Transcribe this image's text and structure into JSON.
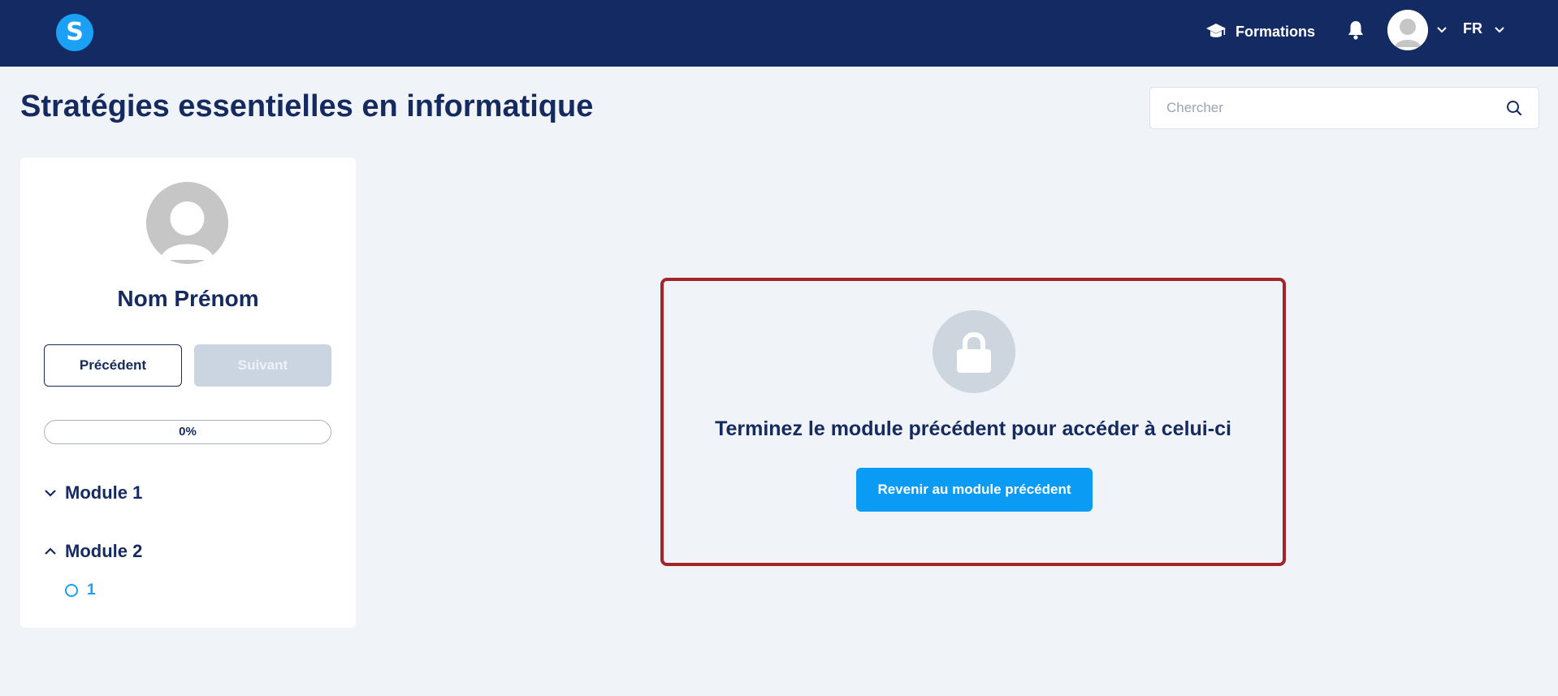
{
  "header": {
    "logo_letter": "S",
    "nav_formations": "Formations",
    "language": "FR"
  },
  "page": {
    "title": "Stratégies essentielles en informatique"
  },
  "search": {
    "placeholder": "Chercher",
    "value": ""
  },
  "sidebar": {
    "user_name": "Nom Prénom",
    "prev_label": "Précédent",
    "next_label": "Suivant",
    "progress_label": "0%",
    "progress_value": 0,
    "modules": [
      {
        "label": "Module 1",
        "expanded": false
      },
      {
        "label": "Module 2",
        "expanded": true,
        "lessons": [
          {
            "label": "1"
          }
        ]
      }
    ]
  },
  "locked": {
    "message": "Terminez le module précédent pour accéder à celui-ci",
    "button_label": "Revenir au module précédent"
  },
  "colors": {
    "header_bg": "#142a63",
    "accent": "#1aa0f5",
    "text_primary": "#152a5f",
    "highlight_border": "#a3252b",
    "page_bg": "#f0f3f8"
  }
}
